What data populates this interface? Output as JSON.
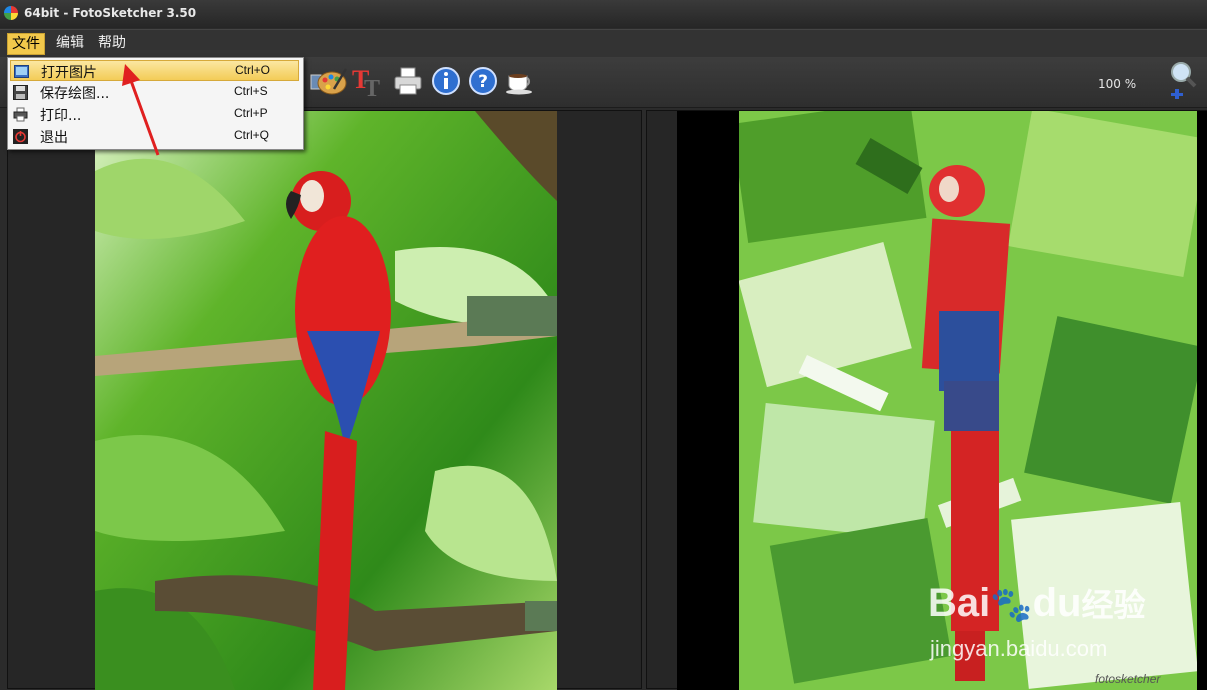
{
  "window": {
    "title": "64bit - FotoSketcher 3.50"
  },
  "menubar": {
    "items": [
      "文件",
      "编辑",
      "帮助"
    ]
  },
  "file_menu": {
    "items": [
      {
        "label": "打开图片",
        "shortcut": "Ctrl+O"
      },
      {
        "label": "保存绘图...",
        "shortcut": "Ctrl+S"
      },
      {
        "label": "打印...",
        "shortcut": "Ctrl+P"
      },
      {
        "label": "退出",
        "shortcut": "Ctrl+Q"
      }
    ]
  },
  "toolbar": {
    "zoom": "100 %"
  },
  "watermark": {
    "brand": "Bai",
    "brand_suffix": "du",
    "cn": "经验",
    "url": "jingyan.baidu.com",
    "signature": "fotosketcher"
  },
  "colors": {
    "menu_highlight": "#f2c84b",
    "arrow": "#e02020"
  }
}
